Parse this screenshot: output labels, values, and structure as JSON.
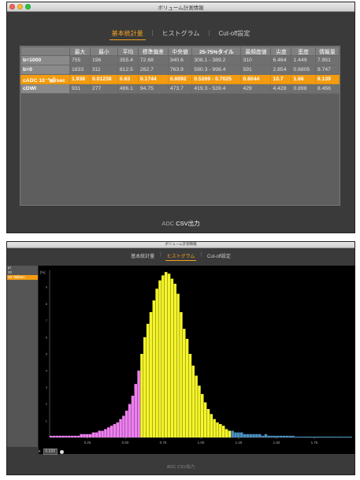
{
  "window": {
    "title": "ボリューム計測情報",
    "tabs": [
      "基本統計量",
      "ヒストグラム",
      "Cut-off設定"
    ],
    "tab_separator": "|"
  },
  "stats_table": {
    "headers": [
      "最大",
      "最小",
      "平均",
      "標準偏差",
      "中央値",
      "25-75%タイル",
      "最頻度値",
      "尖度",
      "歪度",
      "情報量"
    ],
    "rows": [
      {
        "label": "b=1000",
        "cells": [
          "755",
          "196",
          "355.4",
          "72.68",
          "340.6",
          "308.1 - 389.2",
          "310",
          "6.464",
          "1.449",
          "7.951"
        ]
      },
      {
        "label": "b=0",
        "cells": [
          "1833",
          "311",
          "812.5",
          "262.7",
          "763.9",
          "590.3 - 998.4",
          "591",
          "2.854",
          "0.6805",
          "9.747"
        ]
      },
      {
        "label": "cADC 10⁻³㎟/sec",
        "cells": [
          "1.938",
          "0.01238",
          "0.63",
          "0.1744",
          "0.6092",
          "0.5269 - 0.7025",
          "0.6044",
          "10.7",
          "1.66",
          "9.139"
        ]
      },
      {
        "label": "cDWI",
        "cells": [
          "931",
          "277",
          "486.1",
          "94.75",
          "473.7",
          "419.3 - 539.4",
          "429",
          "4.428",
          "0.898",
          "8.456"
        ]
      }
    ]
  },
  "csv_button": {
    "prefix": "ADC ",
    "label": "CSV出力"
  },
  "histogram_window": {
    "title": "ボリューム計測情報",
    "sidebar_items": [
      "pt",
      "00",
      "10⁻³㎟/sec"
    ],
    "zoom_label": "x",
    "zoom_value": "0.020",
    "csv_label": "ADC CSV出力"
  },
  "chart_data": {
    "type": "bar",
    "title": "",
    "xlabel": "",
    "ylabel": "[%]",
    "xlim": [
      0,
      2.0
    ],
    "ylim": [
      0,
      10
    ],
    "x_ticks": [
      "0.25",
      "0.50",
      "0.75",
      "1.00",
      "1.25",
      "1.50",
      "1.75"
    ],
    "y_ticks": [
      "1",
      "2",
      "3",
      "4",
      "5",
      "6",
      "7",
      "8",
      "9"
    ],
    "bin_width": 0.02,
    "threshold": 0.6,
    "colors": {
      "below": "#ee7ff0",
      "above": "#f5f52a",
      "tail": "#4a90c0",
      "axis": "#888888",
      "background": "#000000"
    },
    "values": [
      0.1,
      0.1,
      0.1,
      0.1,
      0.1,
      0.1,
      0.1,
      0.1,
      0.1,
      0.1,
      0.2,
      0.2,
      0.2,
      0.2,
      0.3,
      0.3,
      0.4,
      0.4,
      0.5,
      0.6,
      0.7,
      0.8,
      0.9,
      1.1,
      1.3,
      1.6,
      2.0,
      2.5,
      3.2,
      4.0,
      5.0,
      6.0,
      6.8,
      7.5,
      8.2,
      8.9,
      9.4,
      9.7,
      9.9,
      9.8,
      9.5,
      9.2,
      8.6,
      7.5,
      6.5,
      5.9,
      5.0,
      4.3,
      3.7,
      3.1,
      2.6,
      2.1,
      1.7,
      1.4,
      1.1,
      0.9,
      0.8,
      0.7,
      0.5,
      0.4,
      0.4,
      0.3,
      0.3,
      0.3,
      0.2,
      0.2,
      0.2,
      0.2,
      0.2,
      0.2,
      0.1,
      0.2,
      0.1,
      0.1,
      0.1,
      0.1,
      0.1,
      0.1,
      0.1,
      0.1,
      0.1,
      0.05,
      0.05,
      0.05,
      0.05,
      0.05,
      0.05,
      0.05,
      0.05,
      0.05,
      0.05,
      0.05,
      0.05,
      0.05,
      0.05,
      0.05,
      0.05,
      0.05,
      0.05,
      0.05
    ]
  }
}
